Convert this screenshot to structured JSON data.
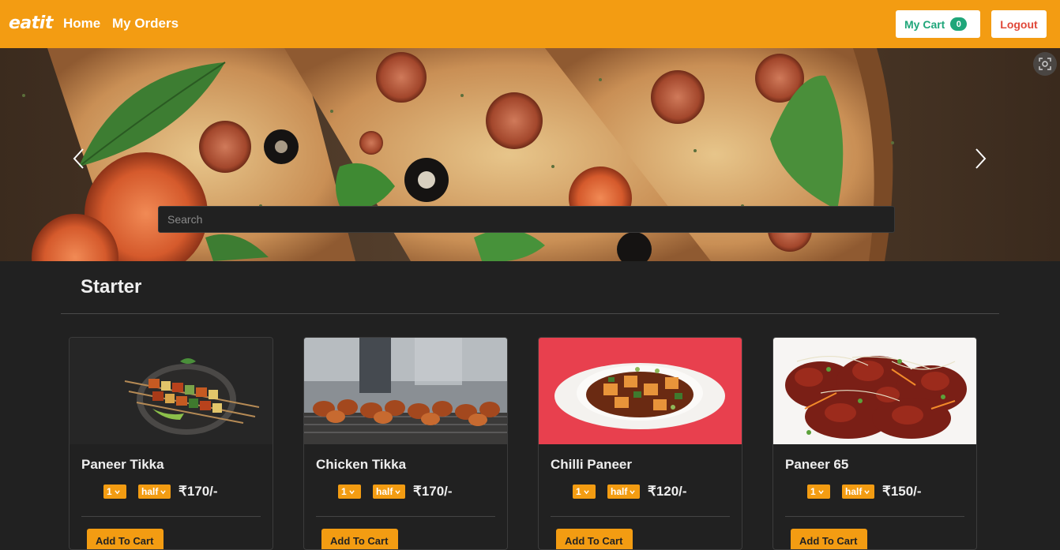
{
  "navbar": {
    "brand": "eatit",
    "links": [
      {
        "label": "Home"
      },
      {
        "label": "My Orders"
      }
    ],
    "cart_label": "My Cart",
    "cart_count": "0",
    "logout_label": "Logout"
  },
  "hero": {
    "search_placeholder": "Search"
  },
  "section": {
    "title": "Starter"
  },
  "items": [
    {
      "name": "Paneer Tikka",
      "qty": "1",
      "size": "half",
      "price": "₹170/-",
      "add_label": "Add To Cart"
    },
    {
      "name": "Chicken Tikka",
      "qty": "1",
      "size": "half",
      "price": "₹170/-",
      "add_label": "Add To Cart"
    },
    {
      "name": "Chilli Paneer",
      "qty": "1",
      "size": "half",
      "price": "₹120/-",
      "add_label": "Add To Cart"
    },
    {
      "name": "Paneer 65",
      "qty": "1",
      "size": "half",
      "price": "₹150/-",
      "add_label": "Add To Cart"
    }
  ],
  "colors": {
    "accent": "#f39c12",
    "background": "#212121",
    "cart_green": "#1fa67a",
    "logout_red": "#e0483a"
  },
  "icons": [
    "chevron-left-icon",
    "chevron-right-icon",
    "lens-icon",
    "chevron-down-icon"
  ]
}
